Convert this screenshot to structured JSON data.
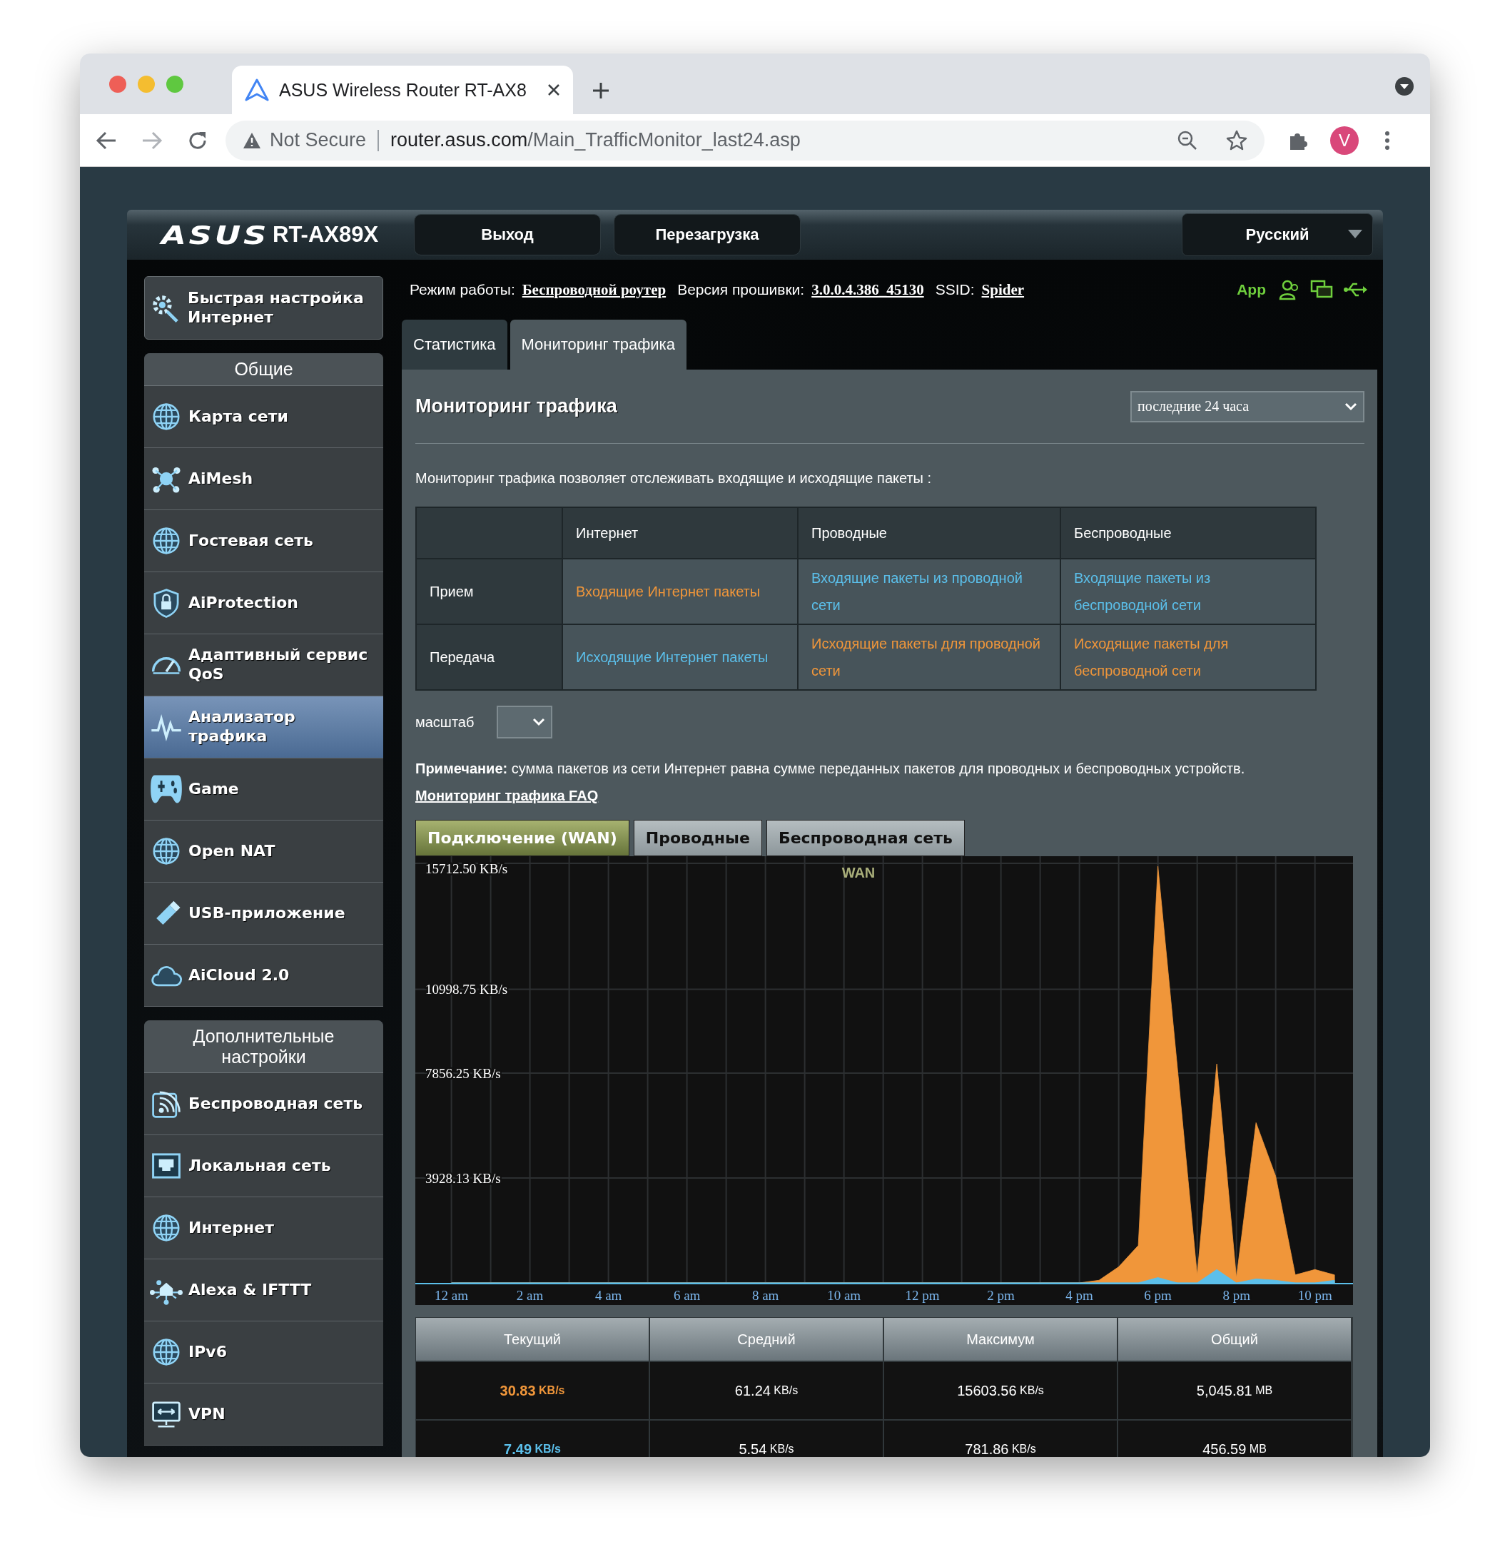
{
  "browser": {
    "tab_title": "ASUS Wireless Router RT-AX8",
    "security": "Not Secure",
    "url_host": "router.asus.com",
    "url_path": "/Main_TrafficMonitor_last24.asp",
    "avatar": "V"
  },
  "header": {
    "logo": "ASUS",
    "model": "RT-AX89X",
    "buttons": [
      "Выход",
      "Перезагрузка"
    ],
    "language": "Русский"
  },
  "info": [
    {
      "label": "Режим работы:",
      "value": "Беспроводной роутер"
    },
    {
      "label": "Версия прошивки:",
      "value": "3.0.0.4.386_45130"
    },
    {
      "label": "SSID:",
      "value": "Spider"
    }
  ],
  "status": {
    "app": "App"
  },
  "sidebar": {
    "quick_setup": "Быстрая настройка Интернет",
    "sections": [
      {
        "title": "Общие",
        "items": [
          {
            "label": "Карта сети",
            "selected": false
          },
          {
            "label": "AiMesh",
            "selected": false
          },
          {
            "label": "Гостевая сеть",
            "selected": false
          },
          {
            "label": "AiProtection",
            "selected": false
          },
          {
            "label": "Адаптивный сервис QoS",
            "selected": false
          },
          {
            "label": "Анализатор трафика",
            "selected": true
          },
          {
            "label": "Game",
            "selected": false
          },
          {
            "label": "Open NAT",
            "selected": false
          },
          {
            "label": "USB-приложение",
            "selected": false
          },
          {
            "label": "AiCloud 2.0",
            "selected": false
          }
        ]
      },
      {
        "title": "Дополнительные настройки",
        "items": [
          {
            "label": "Беспроводная сеть",
            "selected": false
          },
          {
            "label": "Локальная сеть",
            "selected": false
          },
          {
            "label": "Интернет",
            "selected": false
          },
          {
            "label": "Alexa & IFTTT",
            "selected": false
          },
          {
            "label": "IPv6",
            "selected": false
          },
          {
            "label": "VPN",
            "selected": false
          }
        ]
      }
    ]
  },
  "tabs": [
    {
      "label": "Статистика",
      "selected": false
    },
    {
      "label": "Мониторинг трафика",
      "selected": true
    }
  ],
  "panel": {
    "title": "Мониторинг трафика",
    "period": "последние 24 часа",
    "description": "Мониторинг трафика позволяет отслеживать входящие и исходящие пакеты :",
    "table": {
      "columns": [
        "Интернет",
        "Проводные",
        "Беспроводные"
      ],
      "rows": [
        {
          "label": "Прием",
          "cells": [
            {
              "text": "Входящие Интернет пакеты",
              "color": "#f0963a"
            },
            {
              "text": "Входящие пакеты из проводной сети",
              "color": "#5bbfea"
            },
            {
              "text": "Входящие пакеты из беспроводной сети",
              "color": "#5bbfea"
            }
          ]
        },
        {
          "label": "Передача",
          "cells": [
            {
              "text": "Исходящие Интернет пакеты",
              "color": "#5bbfea"
            },
            {
              "text": "Исходящие пакеты для проводной сети",
              "color": "#f0963a"
            },
            {
              "text": "Исходящие пакеты для беспроводной сети",
              "color": "#f0963a"
            }
          ]
        }
      ]
    },
    "scale_label": "масштаб",
    "note": "**Примечание:** сумма пакетов из сети Интернет равна сумме переданных пакетов для проводных и беспроводных устройств.",
    "faq": "Мониторинг трафика FAQ"
  },
  "chart_tabs": [
    {
      "label": "Подключение (WAN)",
      "selected": true
    },
    {
      "label": "Проводные",
      "selected": false
    },
    {
      "label": "Беспроводная сеть",
      "selected": false
    }
  ],
  "graph": {
    "chart_data": {
      "type": "area",
      "title": "WAN",
      "categories": [
        "12 am",
        null,
        null,
        null,
        "2 am",
        null,
        null,
        null,
        "4 am",
        null,
        null,
        null,
        "6 am",
        null,
        null,
        null,
        "8 am",
        null,
        null,
        null,
        "10 am",
        null,
        null,
        null,
        "12 pm",
        null,
        null,
        null,
        "2 pm",
        null,
        null,
        null,
        "4 pm",
        null,
        null,
        null,
        "6 pm",
        null,
        null,
        null,
        "8 pm",
        null,
        null,
        null,
        "10 pm",
        null
      ],
      "series": [
        {
          "color": "#f0963a",
          "values": [
            0,
            0,
            0,
            0,
            0,
            0,
            0,
            0,
            0,
            0,
            0,
            0,
            0,
            0,
            0,
            0,
            0,
            0,
            0,
            0,
            0,
            0,
            0,
            0,
            0,
            0,
            0,
            0,
            0,
            0,
            0,
            0,
            0,
            100,
            600,
            1400,
            15600,
            8000,
            300,
            8200,
            200,
            6000,
            4000,
            300,
            500,
            300
          ]
        },
        {
          "color": "#5bbfea",
          "values": [
            0,
            0,
            0,
            0,
            0,
            0,
            0,
            0,
            0,
            0,
            0,
            0,
            0,
            0,
            0,
            0,
            0,
            0,
            0,
            0,
            0,
            0,
            0,
            0,
            0,
            0,
            0,
            0,
            0,
            0,
            0,
            0,
            0,
            0,
            0,
            0,
            200,
            0,
            0,
            500,
            0,
            150,
            100,
            0,
            0,
            100
          ]
        }
      ],
      "grid": true,
      "ylim": [
        0,
        15712.5
      ],
      "yticks": [
        {
          "value": 3928.13,
          "label": "3928.13 KB/s"
        },
        {
          "value": 7856.25,
          "label": "7856.25 KB/s"
        },
        {
          "value": 10998.75,
          "label": "10998.75 KB/s"
        },
        {
          "value": 15712.5,
          "label": "15712.50 KB/s"
        }
      ]
    }
  },
  "stats": {
    "columns": [
      "Текущий",
      "Средний",
      "Максимум",
      "Общий"
    ],
    "rows": [
      {
        "color": "#f0963a",
        "cells": [
          {
            "value": "30.83",
            "unit": "KB/s"
          },
          {
            "value": "61.24",
            "unit": "KB/s"
          },
          {
            "value": "15603.56",
            "unit": "KB/s"
          },
          {
            "value": "5,045.81",
            "unit": "MB"
          }
        ]
      },
      {
        "color": "#5bbfea",
        "cells": [
          {
            "value": "7.49",
            "unit": "KB/s"
          },
          {
            "value": "5.54",
            "unit": "KB/s"
          },
          {
            "value": "781.86",
            "unit": "KB/s"
          },
          {
            "value": "456.59",
            "unit": "MB"
          }
        ]
      }
    ]
  }
}
